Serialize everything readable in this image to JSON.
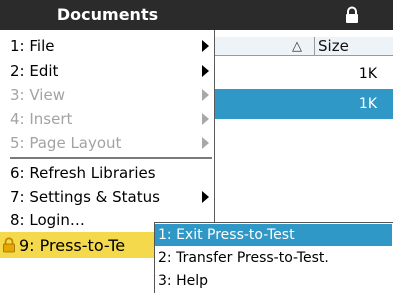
{
  "background": {
    "column_header": "Size",
    "rows": [
      {
        "size": "1K",
        "selected": false
      },
      {
        "size": "1K",
        "selected": true
      }
    ]
  },
  "menu": {
    "title": "Documents",
    "items": [
      {
        "label": "1: File",
        "enabled": true,
        "submenu": true
      },
      {
        "label": "2: Edit",
        "enabled": true,
        "submenu": true
      },
      {
        "label": "3: View",
        "enabled": false,
        "submenu": true
      },
      {
        "label": "4: Insert",
        "enabled": false,
        "submenu": true
      },
      {
        "label": "5: Page Layout",
        "enabled": false,
        "submenu": true
      },
      {
        "label": "6: Refresh Libraries",
        "enabled": true,
        "submenu": false
      },
      {
        "label": "7: Settings & Status",
        "enabled": true,
        "submenu": true
      },
      {
        "label": "8: Login…",
        "enabled": true,
        "submenu": false
      },
      {
        "label": "9: Press-to-Te",
        "enabled": true,
        "submenu": true,
        "highlighted": true
      }
    ]
  },
  "submenu": {
    "items": [
      {
        "label": "1: Exit Press-to-Test",
        "selected": true
      },
      {
        "label": "2: Transfer Press-to-Test.",
        "selected": false
      },
      {
        "label": "3: Help",
        "selected": false
      }
    ]
  },
  "colors": {
    "title_bar": "#2b2b2b",
    "selection_blue": "#2f98c6",
    "press_to_test_yellow": "#f3d94b"
  },
  "icons": {
    "title_bar": "lock-icon",
    "press_to_test": "lock-icon"
  }
}
